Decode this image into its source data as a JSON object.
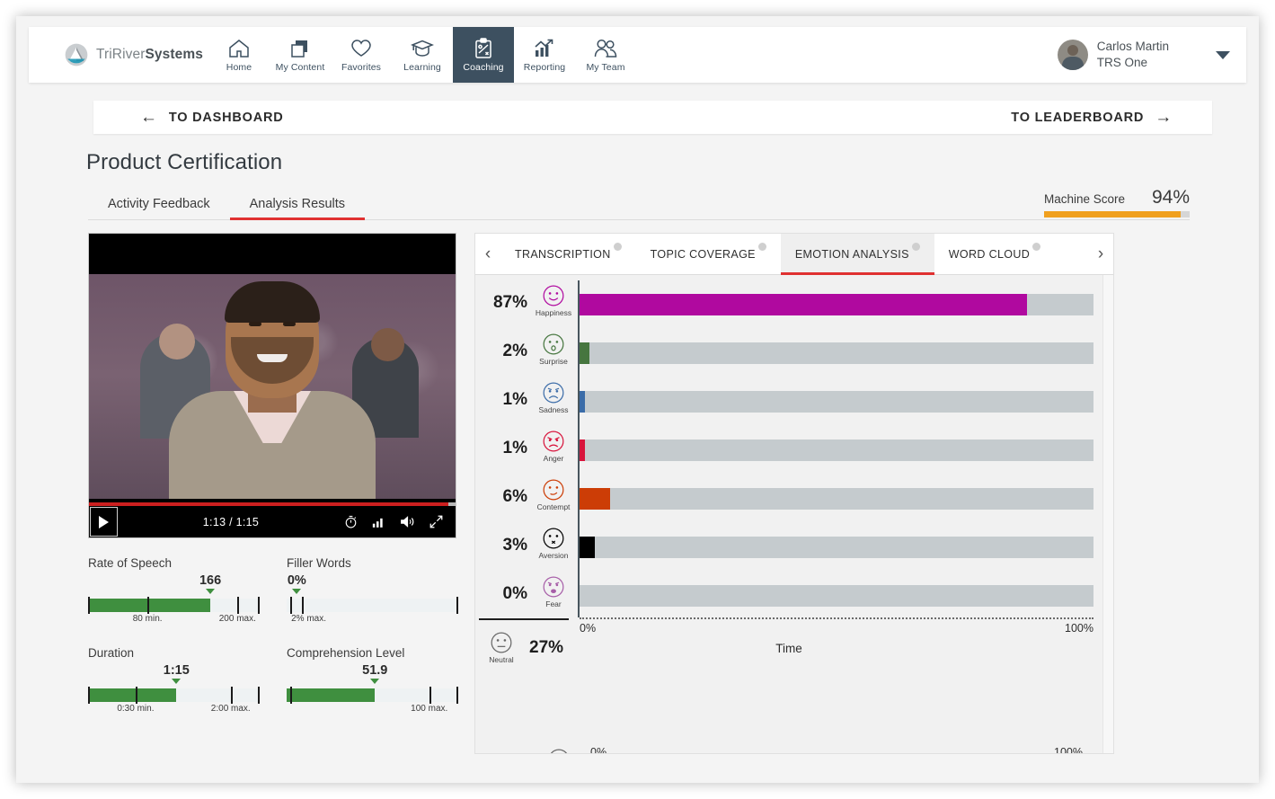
{
  "brand": {
    "name_light": "TriRiver",
    "name_bold": "Systems"
  },
  "topnav": {
    "items": [
      {
        "label": "Home",
        "icon": "home-icon",
        "active": false
      },
      {
        "label": "My Content",
        "icon": "content-icon",
        "active": false
      },
      {
        "label": "Favorites",
        "icon": "heart-icon",
        "active": false
      },
      {
        "label": "Learning",
        "icon": "graduation-cap-icon",
        "active": false
      },
      {
        "label": "Coaching",
        "icon": "clipboard-icon",
        "active": true
      },
      {
        "label": "Reporting",
        "icon": "bar-chart-icon",
        "active": false
      },
      {
        "label": "My Team",
        "icon": "people-icon",
        "active": false
      }
    ],
    "user": {
      "name": "Carlos Martin",
      "org": "TRS One"
    }
  },
  "subbar": {
    "back_label": "TO DASHBOARD",
    "back_arrow": "←",
    "forward_label": "TO LEADERBOARD",
    "forward_arrow": "→"
  },
  "page": {
    "title": "Product Certification",
    "tabs": [
      {
        "label": "Activity Feedback",
        "active": false
      },
      {
        "label": "Analysis Results",
        "active": true
      }
    ],
    "machine_score": {
      "label": "Machine Score",
      "value": "94%",
      "percent": 94,
      "color": "#f0a01e"
    }
  },
  "video": {
    "current_time": "1:13",
    "total_time": "1:15",
    "time_display": "1:13 / 1:15",
    "progress_percent": 98,
    "play_icon": "play-icon",
    "controls": [
      "stopwatch-icon",
      "signal-bars-icon",
      "volume-icon",
      "fullscreen-icon"
    ]
  },
  "metrics": [
    {
      "title": "Rate of Speech",
      "value": "166",
      "marker_percent": 72,
      "fill_percent": 72,
      "ticks": [
        0,
        35,
        88,
        100
      ],
      "labels": [
        {
          "text": "80 min.",
          "pos": 35
        },
        {
          "text": "200 max.",
          "pos": 88
        }
      ]
    },
    {
      "title": "Filler Words",
      "value": "0%",
      "marker_percent": 6,
      "fill_percent": 0,
      "ticks": [
        2,
        9,
        100
      ],
      "labels": [
        {
          "text": "2% max.",
          "pos": 13
        }
      ]
    },
    {
      "title": "Duration",
      "value": "1:15",
      "marker_percent": 52,
      "fill_percent": 52,
      "ticks": [
        0,
        28,
        84,
        100
      ],
      "labels": [
        {
          "text": "0:30 min.",
          "pos": 28
        },
        {
          "text": "2:00 max.",
          "pos": 84
        }
      ]
    },
    {
      "title": "Comprehension Level",
      "value": "51.9",
      "marker_percent": 52,
      "fill_percent": 52,
      "ticks": [
        2,
        84,
        100
      ],
      "labels": [
        {
          "text": "100 max.",
          "pos": 84
        }
      ]
    }
  ],
  "analysis": {
    "prev_arrow": "‹",
    "next_arrow": "›",
    "tabs": [
      {
        "label": "TRANSCRIPTION",
        "active": false
      },
      {
        "label": "TOPIC COVERAGE",
        "active": false
      },
      {
        "label": "EMOTION ANALYSIS",
        "active": true
      },
      {
        "label": "WORD CLOUD",
        "active": false
      }
    ]
  },
  "chart_data": {
    "type": "bar",
    "title": "Emotion Analysis",
    "orientation": "horizontal",
    "xlabel": "Time",
    "ylabel": "",
    "xlim": [
      0,
      100
    ],
    "axis_ticks": [
      "0%",
      "100%"
    ],
    "grid": false,
    "categories": [
      "Happiness",
      "Surprise",
      "Sadness",
      "Anger",
      "Contempt",
      "Aversion",
      "Fear"
    ],
    "values": [
      87,
      2,
      1,
      1,
      6,
      3,
      0
    ],
    "value_labels": [
      "87%",
      "2%",
      "1%",
      "1%",
      "6%",
      "3%",
      "0%"
    ],
    "colors": [
      "#b0099f",
      "#46763f",
      "#3b6ca8",
      "#d8143c",
      "#cc3d06",
      "#000000",
      "#a75ea8"
    ],
    "track_color": "#c5cbce",
    "neutral": {
      "label": "Neutral",
      "value": 27,
      "value_label": "27%"
    },
    "axis_label_left": "0%",
    "axis_label_right": "100%"
  }
}
